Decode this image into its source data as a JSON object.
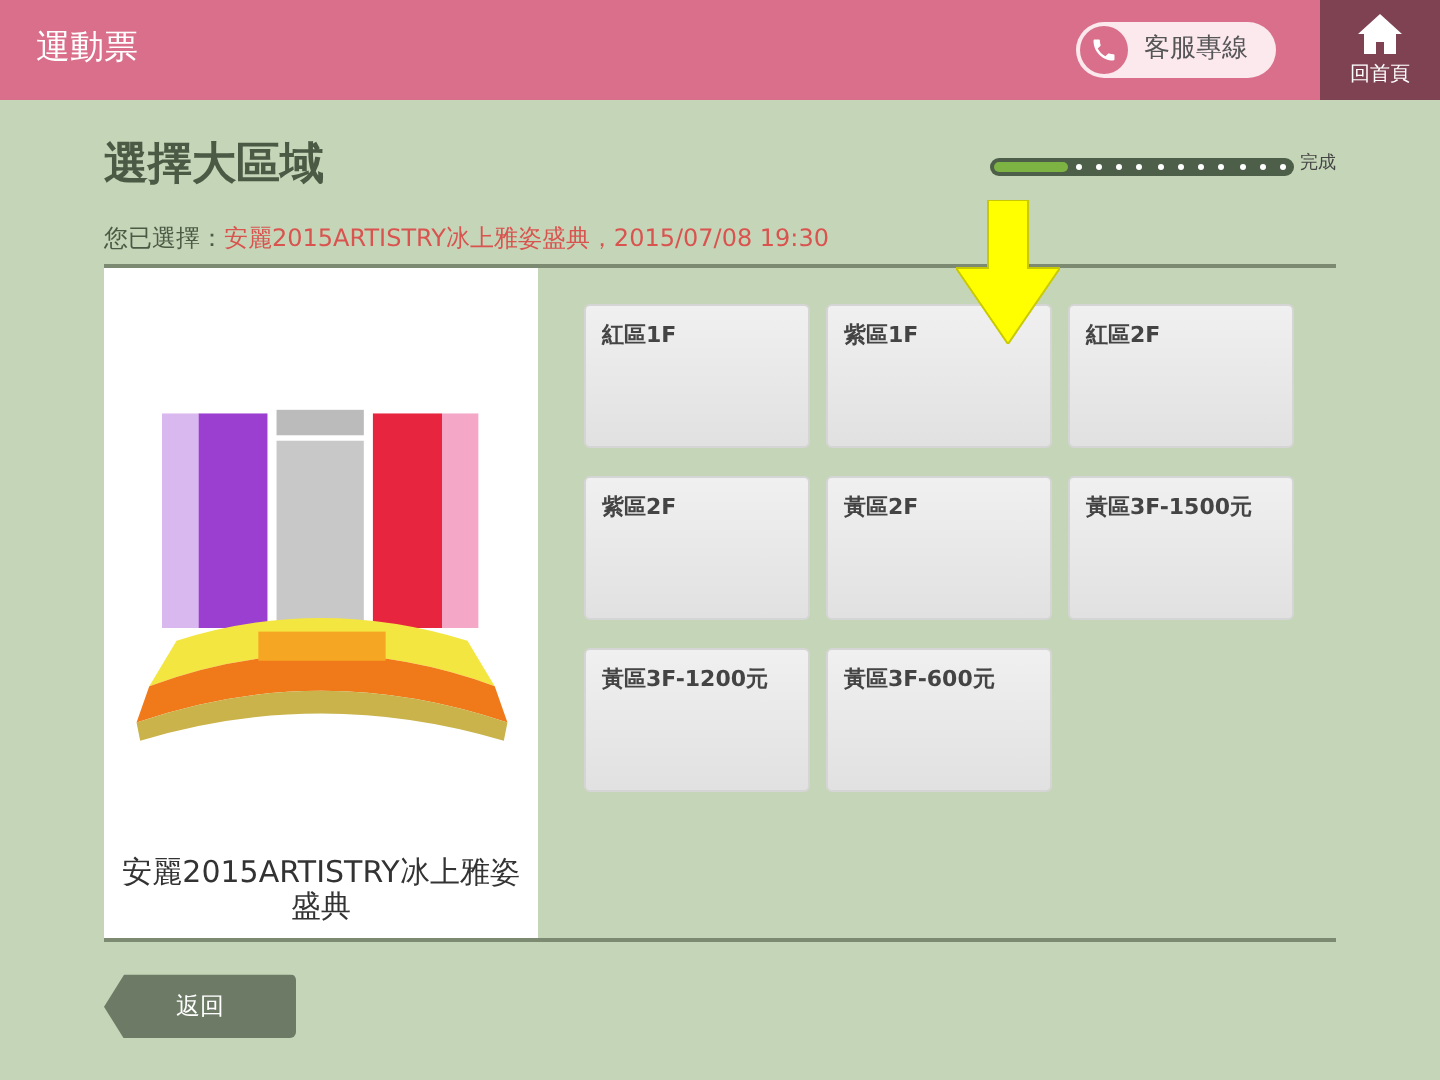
{
  "header": {
    "title": "運動票",
    "hotline": "客服專線",
    "home": "回首頁"
  },
  "page": {
    "title": "選擇大區域",
    "progress": {
      "level": 0.25,
      "label": "完成"
    }
  },
  "selection": {
    "label": "您已選擇：",
    "value": "安麗2015ARTISTRY冰上雅姿盛典，2015/07/08 19:30"
  },
  "seat_map": {
    "kind": "picture",
    "caption": "安麗2015ARTISTRY冰上雅姿盛典"
  },
  "areas": [
    {
      "label": "紅區1F",
      "pointed": false
    },
    {
      "label": "紫區1F",
      "pointed": true
    },
    {
      "label": "紅區2F",
      "pointed": false
    },
    {
      "label": "紫區2F",
      "pointed": false
    },
    {
      "label": "黃區2F",
      "pointed": false
    },
    {
      "label": "黃區3F-1500元",
      "pointed": false
    },
    {
      "label": "黃區3F-1200元",
      "pointed": false
    },
    {
      "label": "黃區3F-600元",
      "pointed": false
    }
  ],
  "back_button": "返回"
}
